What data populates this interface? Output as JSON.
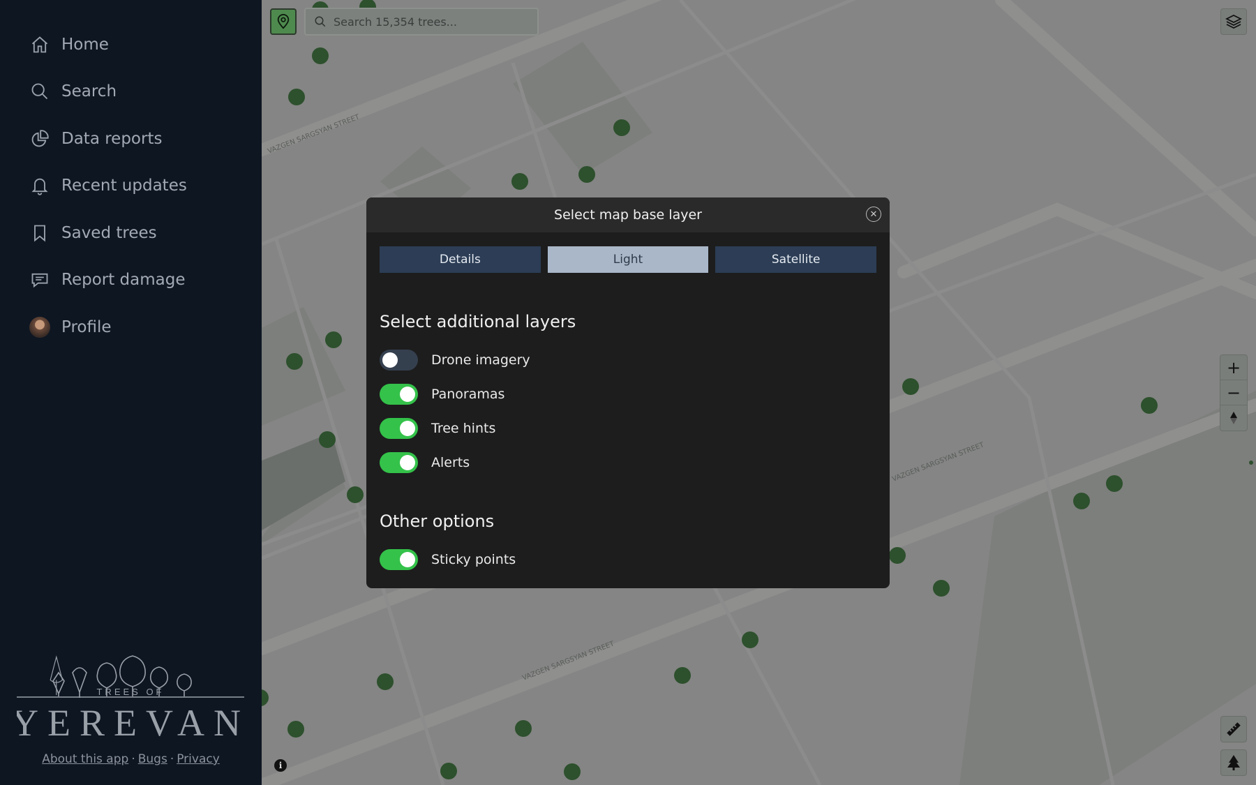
{
  "nav": {
    "items": [
      {
        "label": "Home",
        "icon": "home-icon"
      },
      {
        "label": "Search",
        "icon": "search-icon"
      },
      {
        "label": "Data reports",
        "icon": "pie-chart-icon"
      },
      {
        "label": "Recent updates",
        "icon": "bell-icon"
      },
      {
        "label": "Saved trees",
        "icon": "bookmark-icon"
      },
      {
        "label": "Report damage",
        "icon": "comment-icon"
      },
      {
        "label": "Profile",
        "icon": "avatar"
      }
    ]
  },
  "logo": {
    "line1": "TREES OF",
    "line2": "YEREVAN"
  },
  "footer": {
    "about": "About this app",
    "bugs": "Bugs",
    "privacy": "Privacy",
    "separator": "·"
  },
  "map": {
    "search_placeholder": "Search 15,354 trees...",
    "street_labels": [
      "VAZGEN SARGSYAN STREET",
      "VAZGEN SARGSYAN STREET",
      "VAZGEN SARGSYAN STREET"
    ],
    "info_label": "i",
    "zoom_in": "+",
    "zoom_out": "−"
  },
  "modal": {
    "title": "Select map base layer",
    "base_layers": [
      {
        "label": "Details",
        "active": false
      },
      {
        "label": "Light",
        "active": true
      },
      {
        "label": "Satellite",
        "active": false
      }
    ],
    "additional_title": "Select additional layers",
    "layers": [
      {
        "label": "Drone imagery",
        "on": false
      },
      {
        "label": "Panoramas",
        "on": true
      },
      {
        "label": "Tree hints",
        "on": true
      },
      {
        "label": "Alerts",
        "on": true
      }
    ],
    "other_title": "Other options",
    "options": [
      {
        "label": "Sticky points",
        "on": true
      }
    ]
  },
  "colors": {
    "sidebar_bg": "#0e1622",
    "toggle_on": "#34c24a",
    "toggle_off": "#35404f",
    "segment_bg": "#2c3d55",
    "segment_active": "#a9b7c8",
    "tree_marker": "#4f8a4f"
  }
}
